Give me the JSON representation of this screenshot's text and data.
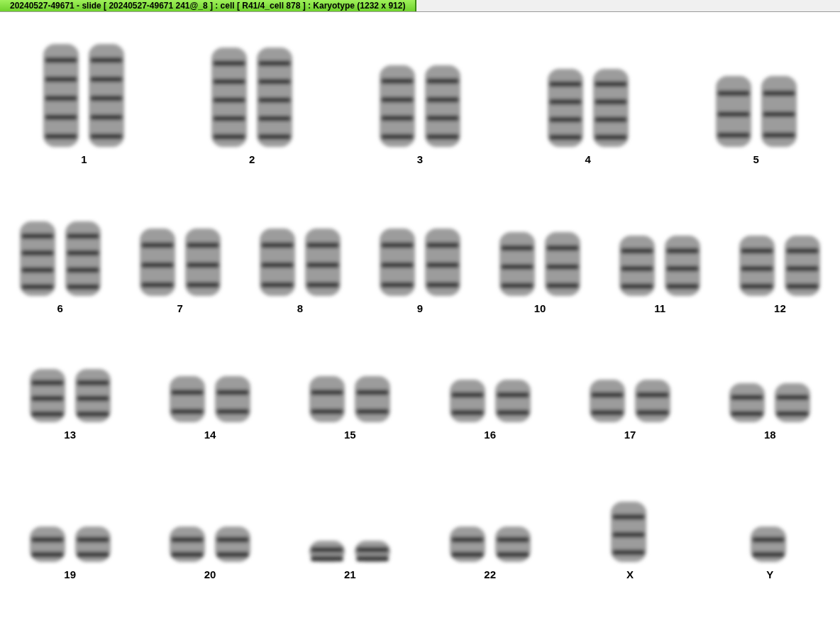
{
  "window": {
    "title": "20240527-49671 - slide [ 20240527-49671 241@_8 ] : cell [ R41/4_cell 878 ] : Karyotype  (1232 x 912)"
  },
  "karyotype_rows": [
    {
      "chromosomes": [
        {
          "label": "1",
          "kind": "pair"
        },
        {
          "label": "2",
          "kind": "pair"
        },
        {
          "label": "3",
          "kind": "pair"
        },
        {
          "label": "4",
          "kind": "pair"
        },
        {
          "label": "5",
          "kind": "pair"
        }
      ]
    },
    {
      "chromosomes": [
        {
          "label": "6",
          "kind": "pair"
        },
        {
          "label": "7",
          "kind": "pair"
        },
        {
          "label": "8",
          "kind": "pair"
        },
        {
          "label": "9",
          "kind": "pair"
        },
        {
          "label": "10",
          "kind": "pair"
        },
        {
          "label": "11",
          "kind": "pair"
        },
        {
          "label": "12",
          "kind": "pair"
        }
      ]
    },
    {
      "chromosomes": [
        {
          "label": "13",
          "kind": "pair"
        },
        {
          "label": "14",
          "kind": "pair"
        },
        {
          "label": "15",
          "kind": "pair"
        },
        {
          "label": "16",
          "kind": "pair"
        },
        {
          "label": "17",
          "kind": "pair"
        },
        {
          "label": "18",
          "kind": "pair"
        }
      ]
    },
    {
      "chromosomes": [
        {
          "label": "19",
          "kind": "pair"
        },
        {
          "label": "20",
          "kind": "pair"
        },
        {
          "label": "21",
          "kind": "pair"
        },
        {
          "label": "22",
          "kind": "pair"
        },
        {
          "label": "X",
          "kind": "single"
        },
        {
          "label": "Y",
          "kind": "single"
        }
      ]
    }
  ]
}
